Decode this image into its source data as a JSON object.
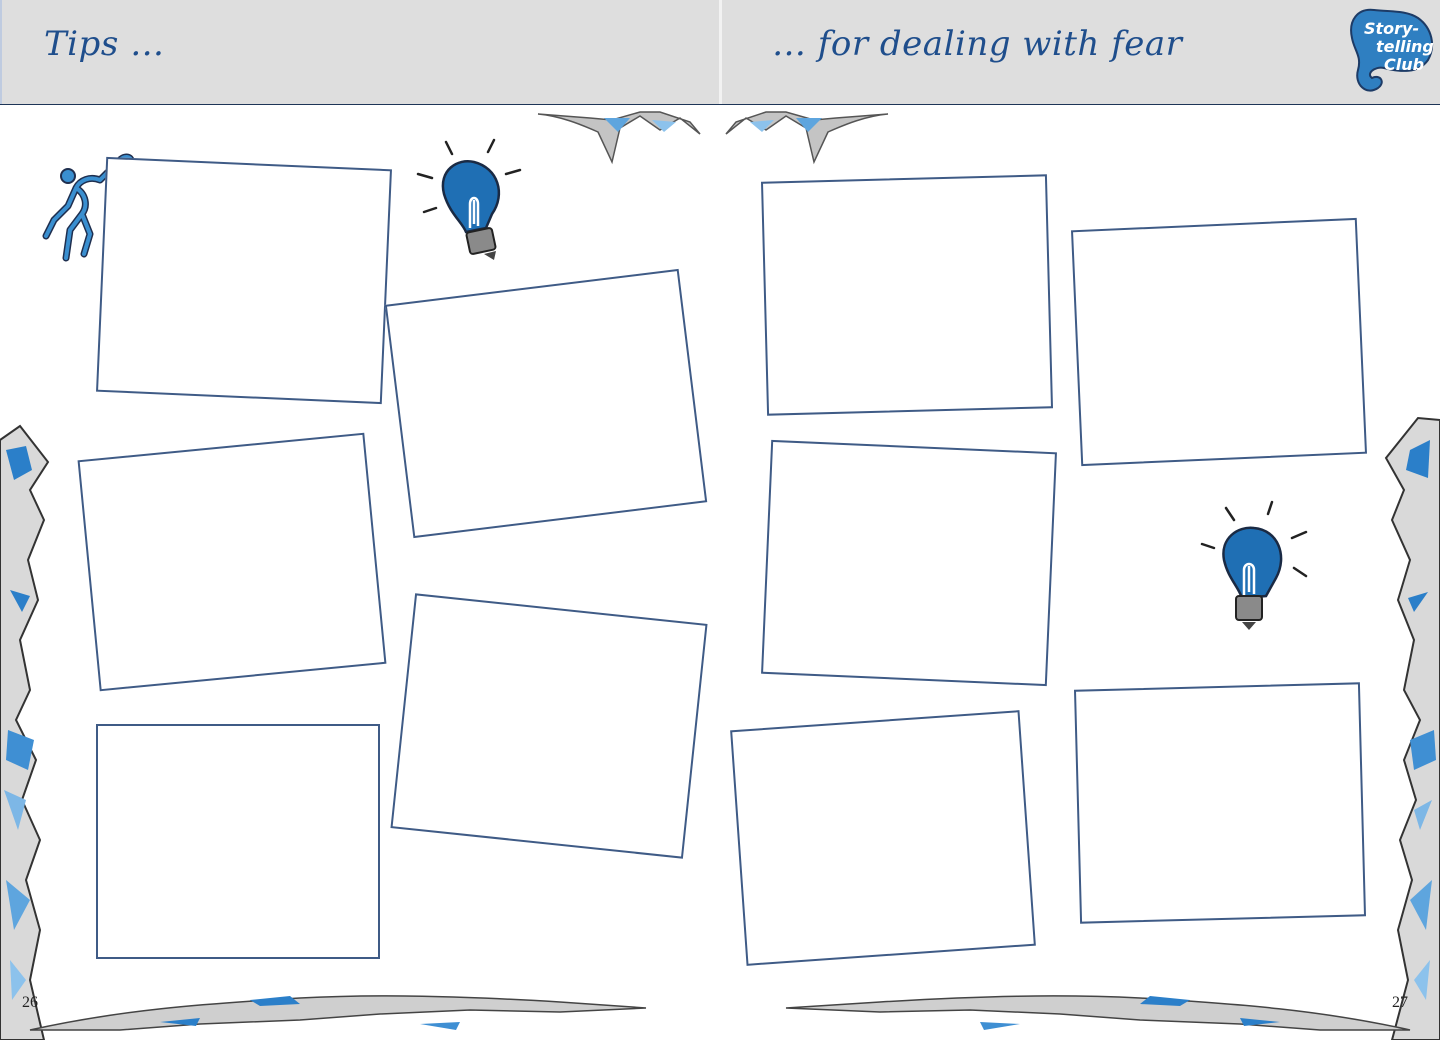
{
  "header": {
    "left_title": "Tips …",
    "right_title": "… for dealing with fear"
  },
  "logo": {
    "line1": "Story-",
    "line2": "telling",
    "line3": "Club",
    "color": "#2f7fc1"
  },
  "pages": {
    "left": "26",
    "right": "27"
  },
  "frames": {
    "left_page_count": 6,
    "right_page_count": 6
  },
  "colors": {
    "accent": "#1f6fb4",
    "frame_border": "#3f5b86",
    "header_bg": "#dedede",
    "title": "#1f4e8c"
  },
  "icons": [
    "lightbulb-icon",
    "lightbulb-icon",
    "climber-icon",
    "storytelling-club-logo"
  ]
}
